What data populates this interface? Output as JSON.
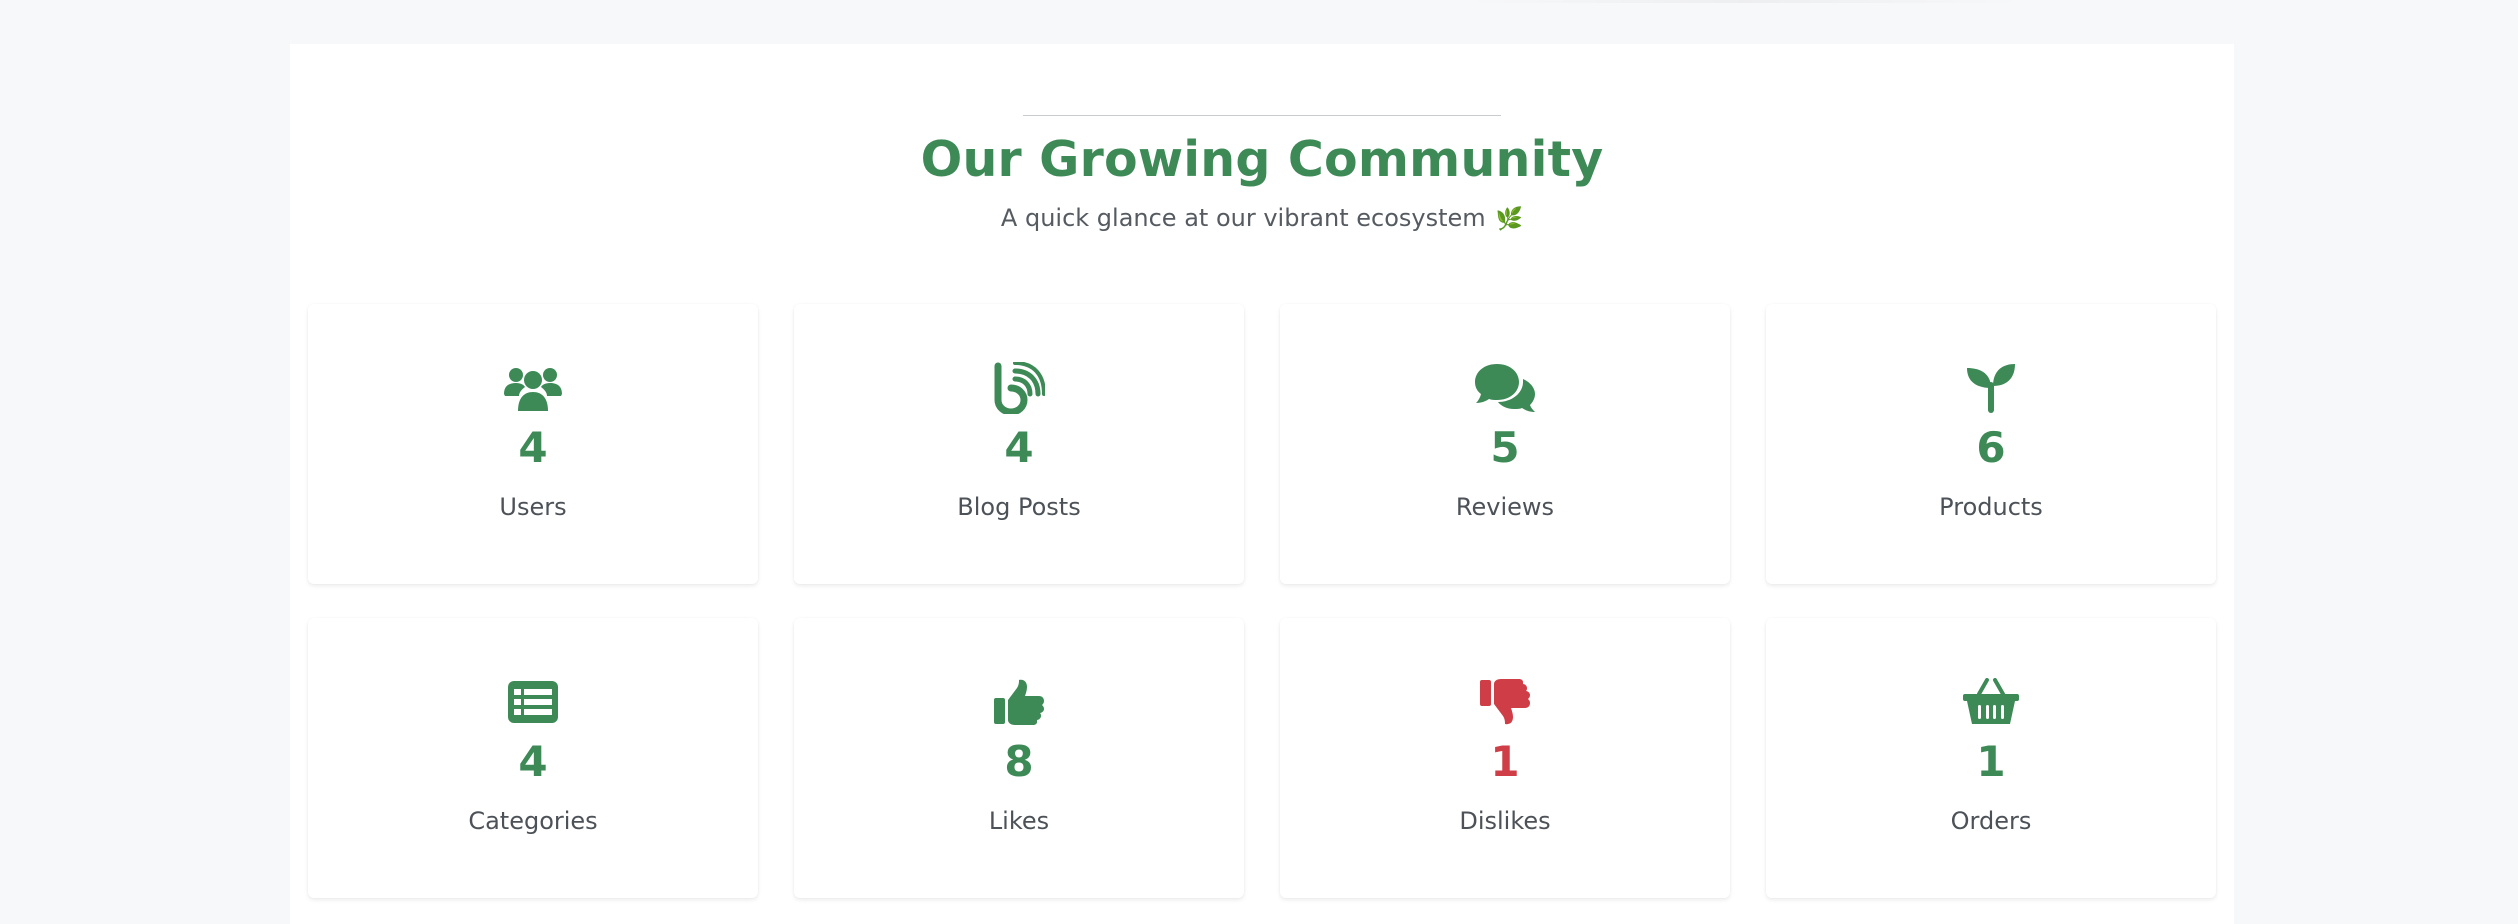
{
  "colors": {
    "accent": "#3d8a57",
    "negative": "#cf3e46",
    "text_muted": "#555b61",
    "background": "#f7f8fa"
  },
  "section": {
    "title": "Our Growing Community",
    "subtitle": "A quick glance at our vibrant ecosystem",
    "subtitle_icon": "herb-leaf-icon"
  },
  "stats": [
    {
      "label": "Users",
      "value": "4",
      "icon": "users-icon"
    },
    {
      "label": "Blog Posts",
      "value": "4",
      "icon": "blog-icon"
    },
    {
      "label": "Reviews",
      "value": "5",
      "icon": "comments-icon"
    },
    {
      "label": "Products",
      "value": "6",
      "icon": "seedling-icon"
    },
    {
      "label": "Categories",
      "value": "4",
      "icon": "list-icon"
    },
    {
      "label": "Likes",
      "value": "8",
      "icon": "thumbs-up-icon"
    },
    {
      "label": "Dislikes",
      "value": "1",
      "icon": "thumbs-down-icon"
    },
    {
      "label": "Orders",
      "value": "1",
      "icon": "basket-icon"
    }
  ]
}
